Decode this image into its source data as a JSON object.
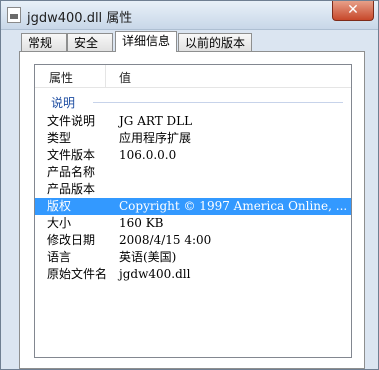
{
  "window": {
    "title": "jgdw400.dll 属性",
    "close_glyph": "✕"
  },
  "tabs": [
    {
      "label": "常规"
    },
    {
      "label": "安全"
    },
    {
      "label": "详细信息"
    },
    {
      "label": "以前的版本"
    }
  ],
  "details": {
    "header": {
      "property": "属性",
      "value": "值"
    },
    "group_label": "说明",
    "rows": [
      {
        "name": "文件说明",
        "value": "JG ART DLL"
      },
      {
        "name": "类型",
        "value": "应用程序扩展"
      },
      {
        "name": "文件版本",
        "value": "106.0.0.0"
      },
      {
        "name": "产品名称",
        "value": ""
      },
      {
        "name": "产品版本",
        "value": ""
      },
      {
        "name": "版权",
        "value": "Copyright © 1997 America Online, ..."
      },
      {
        "name": "大小",
        "value": "160 KB"
      },
      {
        "name": "修改日期",
        "value": "2008/4/15 4:00"
      },
      {
        "name": "语言",
        "value": "英语(美国)"
      },
      {
        "name": "原始文件名",
        "value": "jgdw400.dll"
      }
    ],
    "selected_row": "版权"
  },
  "colors": {
    "selection": "#3399ff",
    "group_text": "#1e4da1"
  }
}
